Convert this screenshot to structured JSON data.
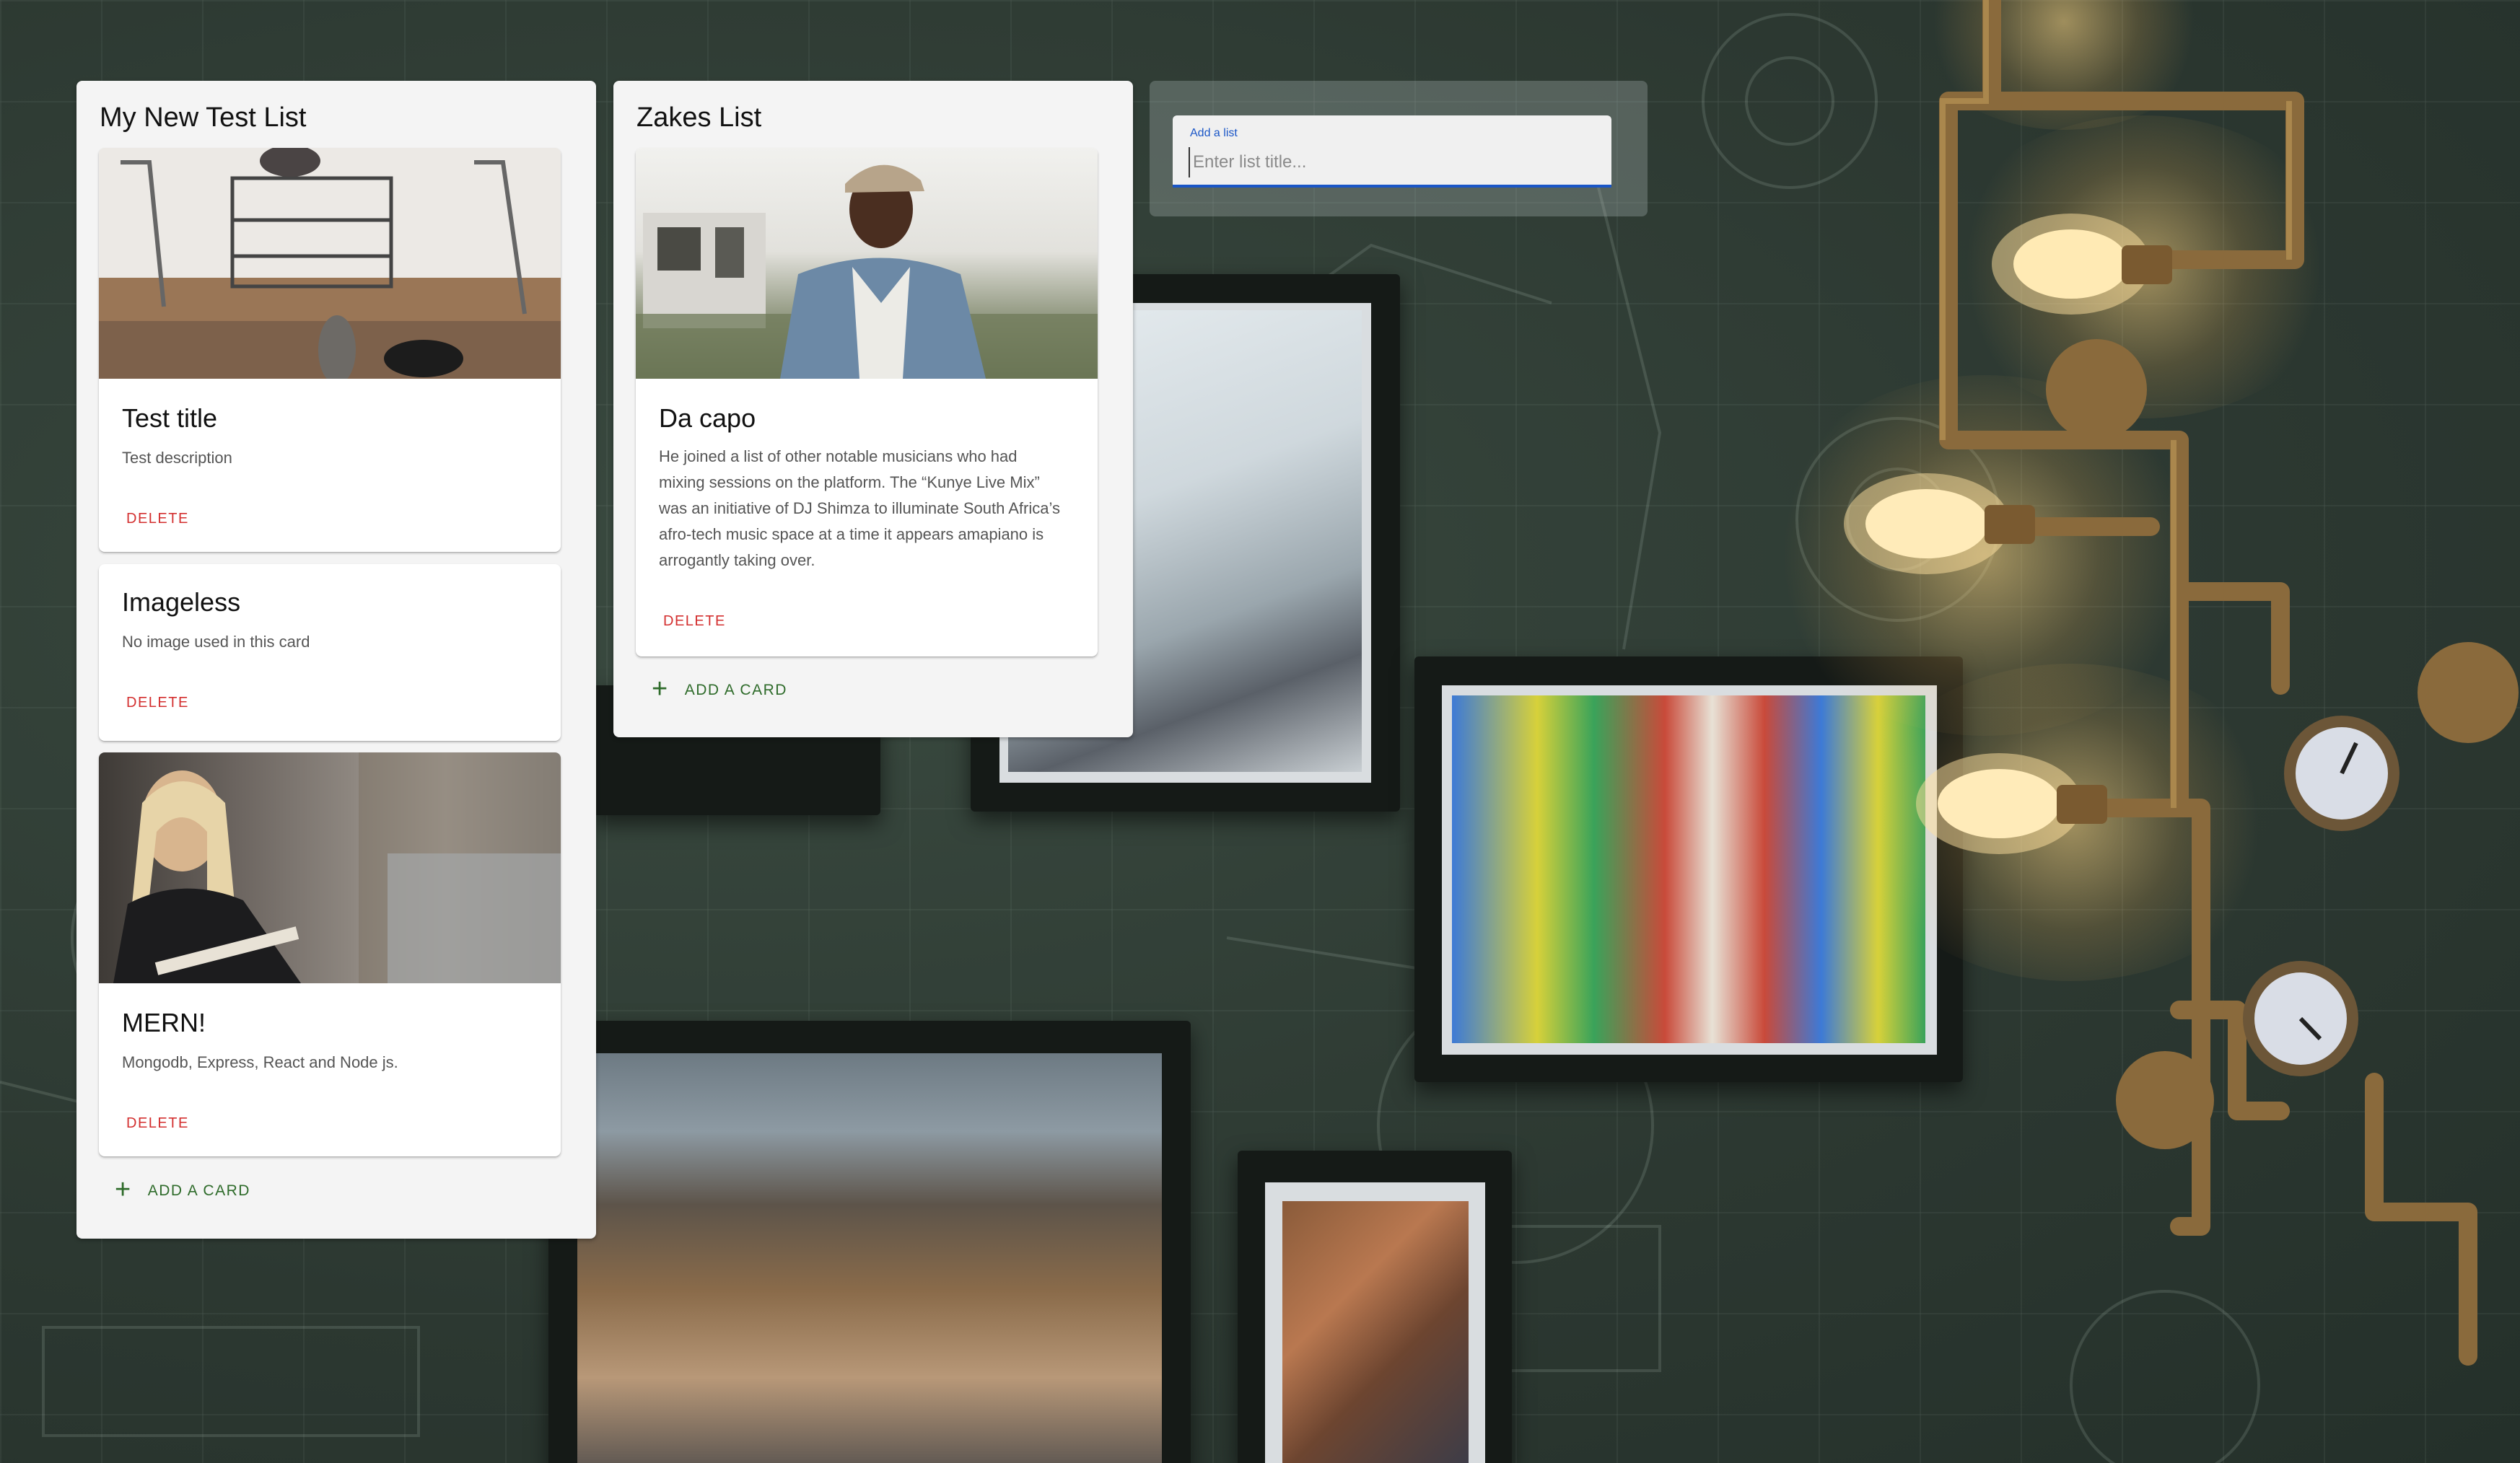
{
  "board": {
    "lists": [
      {
        "title": "My New Test List",
        "cards": [
          {
            "title": "Test title",
            "description": "Test description",
            "delete_label": "DELETE",
            "image": "cats-with-chairs-photo"
          },
          {
            "title": "Imageless",
            "description": "No image used in this card",
            "delete_label": "DELETE"
          },
          {
            "title": "MERN!",
            "description": "Mongodb, Express, React and Node js.",
            "delete_label": "DELETE",
            "image": "blonde-woman-street-photo"
          }
        ],
        "add_card_label": "ADD A CARD"
      },
      {
        "title": "Zakes List",
        "cards": [
          {
            "title": "Da capo",
            "description": "He joined a list of other notable musicians who had mixing sessions on the platform. The “Kunye Live Mix” was an initiative of DJ Shimza to illuminate South Africa’s afro-tech music space at a time it appears amapiano is arrogantly taking over.",
            "delete_label": "DELETE",
            "image": "man-in-cap-denim-jacket-photo"
          }
        ],
        "add_card_label": "ADD A CARD"
      }
    ]
  },
  "add_list": {
    "label": "Add a list",
    "placeholder": "Enter list title..."
  },
  "colors": {
    "delete": "#d32f2f",
    "add_card": "#2e6b2a",
    "input_accent": "#1a56c7",
    "list_bg": "#f4f4f4"
  },
  "icons": {
    "add_card": "plus-icon"
  },
  "background": "green blueprint wall with framed photos and edison bulb pipe lamps"
}
